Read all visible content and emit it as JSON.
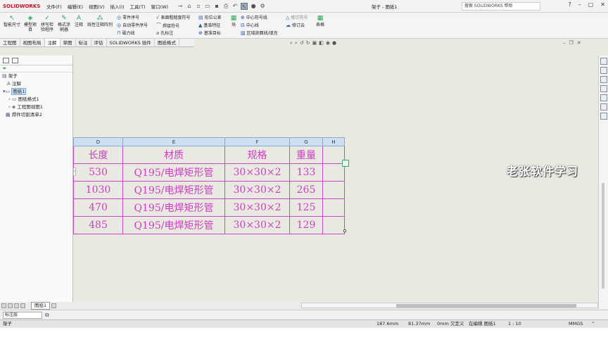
{
  "app": {
    "logo_text": "SOLIDWORKS",
    "document_title": "架子 - 图纸1",
    "search_placeholder": "搜索 SOLIDWORKS 帮助",
    "menu": [
      "文件(F)",
      "编辑(E)",
      "视图(V)",
      "插入(I)",
      "工具(T)",
      "窗口(W)"
    ]
  },
  "ribbon": {
    "large_buttons": [
      {
        "label": "智能尺寸",
        "icon": "smart-dimension-icon"
      },
      {
        "label": "模型项目",
        "icon": "model-items-icon"
      },
      {
        "label": "拼写检验程序",
        "icon": "spell-check-icon"
      },
      {
        "label": "格式涂刷器",
        "icon": "format-painter-icon"
      },
      {
        "label": "注释",
        "icon": "note-icon"
      },
      {
        "label": "线性注释阵列",
        "icon": "linear-note-pattern-icon"
      }
    ],
    "small_buttons_col1": [
      "零件序号",
      "自动零件序号",
      "磁力线"
    ],
    "small_buttons_col2": [
      "表面粗糙度符号",
      "焊接符号",
      "孔标注"
    ],
    "small_buttons_col3": [
      "形位公差",
      "基准特征",
      "基准目标"
    ],
    "block_label": "块",
    "small_buttons_col4": [
      "中心符号线",
      "中心线",
      "区域剖面线/填充"
    ],
    "small_buttons_col5": [
      "修订符号",
      "修订云"
    ],
    "table_label": "表格"
  },
  "tabs": [
    "工程图",
    "视图布局",
    "注解",
    "草图",
    "标注",
    "评估",
    "SOLIDWORKS 插件",
    "图纸格式"
  ],
  "selected_tab": "注解",
  "tree": {
    "root": "架子",
    "items": [
      "注解",
      "图纸1",
      "图纸格式1",
      "工程图视图1",
      "焊件切割清单2"
    ]
  },
  "bom_table": {
    "column_letters": [
      "D",
      "E",
      "F",
      "G",
      "H"
    ],
    "headers": [
      "长度",
      "材质",
      "规格",
      "重量",
      ""
    ],
    "rows": [
      [
        "530",
        "Q195/电焊矩形管",
        "30×30×2",
        "133",
        ""
      ],
      [
        "1030",
        "Q195/电焊矩形管",
        "30×30×2",
        "265",
        ""
      ],
      [
        "470",
        "Q195/电焊矩形管",
        "30×30×2",
        "125",
        ""
      ],
      [
        "485",
        "Q195/电焊矩形管",
        "30×30×2",
        "129",
        ""
      ]
    ]
  },
  "watermark": "老张软件学习",
  "sheet_tab": "图纸1",
  "layer_select": "标注层",
  "status": {
    "name": "架子",
    "x": "187.6mm",
    "y": "81.37mm",
    "z": "0mm",
    "state": "欠定义",
    "editing": "在编辑 图纸1",
    "scale": "1 : 10",
    "units": "MMGS"
  },
  "colors": {
    "table_text": "#cc3ec2",
    "canvas_bg": "#e9e9e1"
  }
}
